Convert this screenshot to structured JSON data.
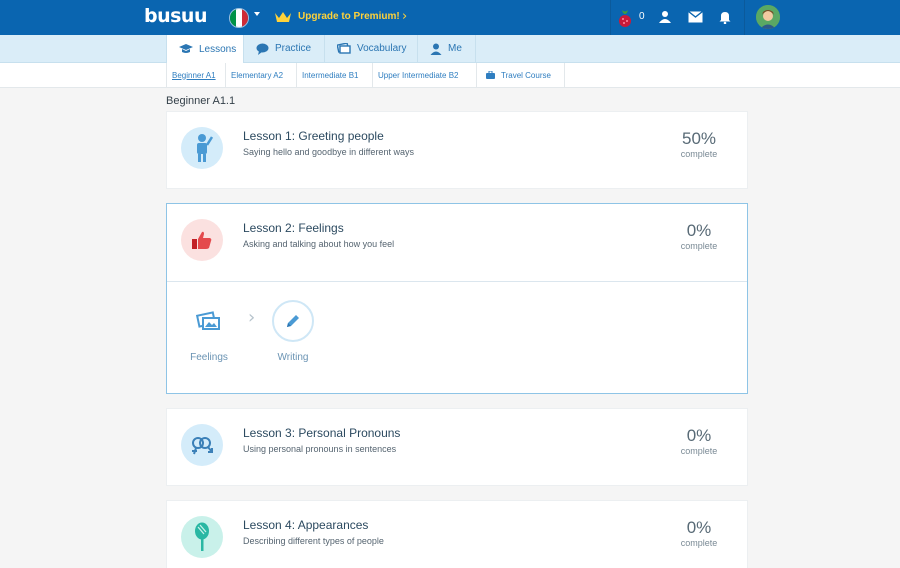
{
  "header": {
    "logo": "busuu",
    "language_flag": "italy-flag",
    "upgrade_label": "Upgrade to Premium!",
    "berry_count": "0",
    "colors": {
      "bar": "#0a65b0",
      "upgrade": "#ffd23a"
    }
  },
  "tabs": [
    {
      "label": "Lessons",
      "icon": "graduation-cap-icon",
      "active": true
    },
    {
      "label": "Practice",
      "icon": "chat-bubble-icon"
    },
    {
      "label": "Vocabulary",
      "icon": "flashcard-icon"
    },
    {
      "label": "Me",
      "icon": "user-icon"
    }
  ],
  "levels": [
    {
      "label": "Beginner A1",
      "active": true
    },
    {
      "label": "Elementary A2"
    },
    {
      "label": "Intermediate B1"
    },
    {
      "label": "Upper Intermediate B2"
    },
    {
      "label": "Travel Course",
      "icon": "suitcase-icon"
    }
  ],
  "section_title": "Beginner A1.1",
  "lessons": [
    {
      "title": "Lesson 1: Greeting people",
      "subtitle": "Saying hello and goodbye in different ways",
      "percent": "50%",
      "percent_label": "complete",
      "icon": "person-waving-icon"
    },
    {
      "title": "Lesson 2: Feelings",
      "subtitle": "Asking and talking about how you feel",
      "percent": "0%",
      "percent_label": "complete",
      "icon": "thumbs-up-icon",
      "activities": [
        {
          "label": "Feelings",
          "icon": "flashcards-icon"
        },
        {
          "label": "Writing",
          "icon": "pencil-icon"
        }
      ]
    },
    {
      "title": "Lesson 3: Personal Pronouns",
      "subtitle": "Using personal pronouns in sentences",
      "percent": "0%",
      "percent_label": "complete",
      "icon": "gender-symbols-icon"
    },
    {
      "title": "Lesson 4: Appearances",
      "subtitle": "Describing different types of people",
      "percent": "0%",
      "percent_label": "complete",
      "icon": "mirror-icon"
    }
  ]
}
